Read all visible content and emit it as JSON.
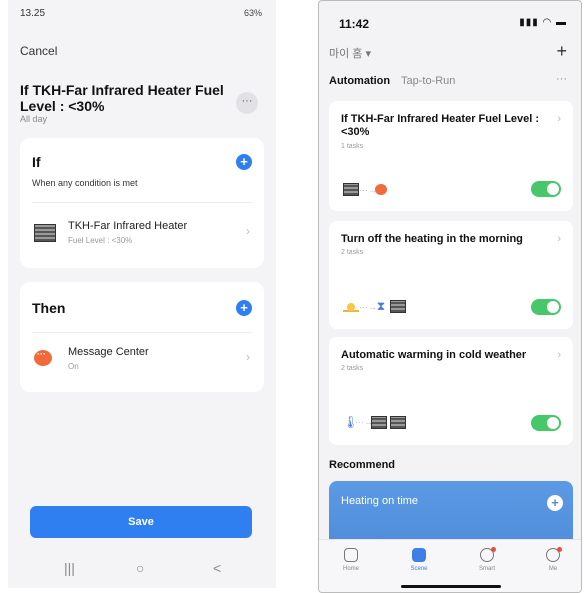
{
  "left": {
    "status": {
      "time": "13.25",
      "right": "63%"
    },
    "cancel": "Cancel",
    "title": "If TKH-Far Infrared Heater Fuel Level : <30%",
    "subtitle": "All day",
    "more": "···",
    "if_section": {
      "title": "If",
      "desc": "When any condition is met",
      "plus": "+",
      "item": {
        "title": "TKH-Far Infrared Heater",
        "sub": "Fuel Level : <30%",
        "chevron": "›"
      }
    },
    "then_section": {
      "title": "Then",
      "plus": "+",
      "item": {
        "title": "Message Center",
        "sub": "On",
        "chevron": "›"
      }
    },
    "save": "Save",
    "nav": {
      "recent": "|||",
      "home": "○",
      "back": "<"
    }
  },
  "right": {
    "status": {
      "time": "11:42",
      "icons": "▮▮▮ ◠ ▬"
    },
    "home_name": "마이 홈 ▾",
    "add": "+",
    "tabs": {
      "automation": "Automation",
      "tap": "Tap-to-Run",
      "more": "···"
    },
    "cards": [
      {
        "title": "If TKH-Far Infrared Heater Fuel Level : <30%",
        "tasks": "1 tasks",
        "chevron": "›"
      },
      {
        "title": "Turn off the heating in the morning",
        "tasks": "2 tasks",
        "chevron": "›"
      },
      {
        "title": "Automatic warming in cold weather",
        "tasks": "2 tasks",
        "chevron": "›"
      }
    ],
    "recommend": "Recommend",
    "heating_card": {
      "title": "Heating on time",
      "plus": "+"
    },
    "nav": [
      {
        "label": "Home"
      },
      {
        "label": "Scene"
      },
      {
        "label": "Smart"
      },
      {
        "label": "Me"
      }
    ]
  }
}
